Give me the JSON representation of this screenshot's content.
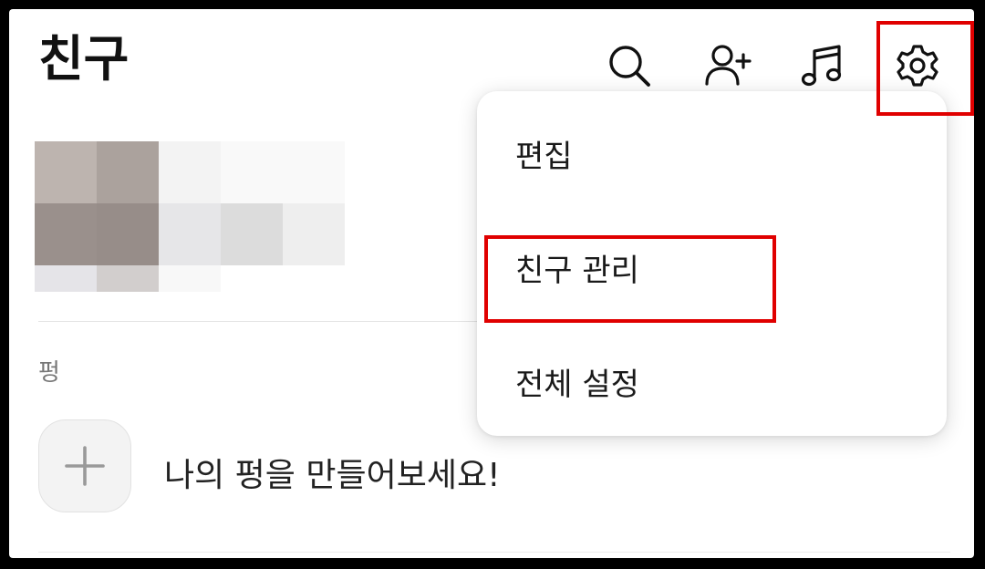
{
  "header": {
    "title": "친구",
    "icons": [
      "search-icon",
      "add-friend-icon",
      "music-icon",
      "settings-gear-icon"
    ]
  },
  "section": {
    "label": "펑",
    "add_prompt": "나의 펑을 만들어보세요!"
  },
  "dropdown_menu": {
    "items": [
      {
        "label": "편집"
      },
      {
        "label": "친구 관리"
      },
      {
        "label": "전체 설정"
      }
    ]
  },
  "colors": {
    "highlight": "#e00000",
    "background": "#ffffff",
    "text": "#111111",
    "muted_text": "#777777"
  }
}
